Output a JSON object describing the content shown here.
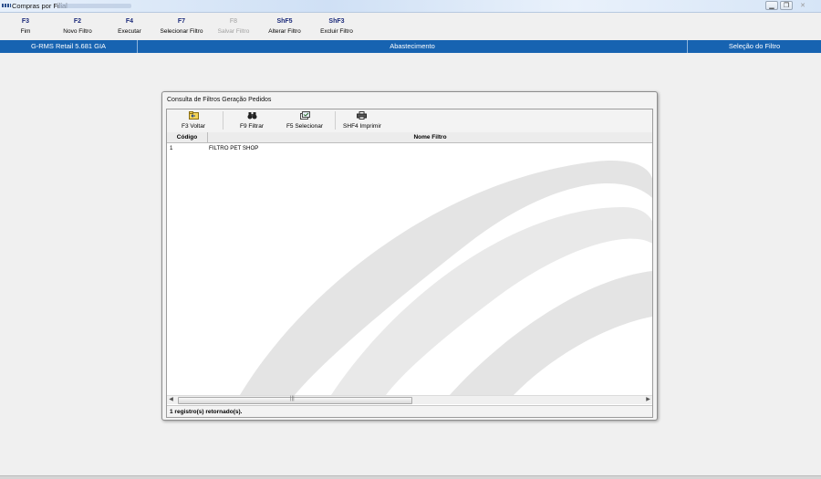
{
  "window": {
    "title": "Compras por Filial",
    "controls": [
      "minimize-icon",
      "restore-icon",
      "close-icon"
    ]
  },
  "toolbar": {
    "items": [
      {
        "key": "F3",
        "label": "Fim"
      },
      {
        "key": "F2",
        "label": "Novo Filtro"
      },
      {
        "key": "F4",
        "label": "Executar"
      },
      {
        "key": "F7",
        "label": "Selecionar Filtro"
      },
      {
        "key": "F8",
        "label": "Salvar Filtro",
        "disabled": true
      },
      {
        "key": "ShF5",
        "label": "Alterar Filtro"
      },
      {
        "key": "ShF3",
        "label": "Excluir Filtro"
      }
    ]
  },
  "header": {
    "left": "G-RMS Retail 5.681 GIA",
    "center": "Abastecimento",
    "right": "Seleção do Filtro",
    "color": "#1763b1"
  },
  "dialog": {
    "title": "Consulta de Filtros Geração Pedidos",
    "toolbar": [
      {
        "icon": "folder-back-icon",
        "label": "F3 Voltar"
      },
      {
        "icon": "binoculars-icon",
        "label": "F9 Filtrar"
      },
      {
        "icon": "select-icon",
        "label": "F5 Selecionar"
      },
      {
        "icon": "printer-icon",
        "label": "SHF4 Imprimir"
      }
    ],
    "columns": [
      "Código",
      "Nome Filtro"
    ],
    "rows": [
      {
        "code": "1",
        "name": "FILTRO PET SHOP"
      }
    ],
    "status": "1 registro(s) retornado(s)."
  }
}
